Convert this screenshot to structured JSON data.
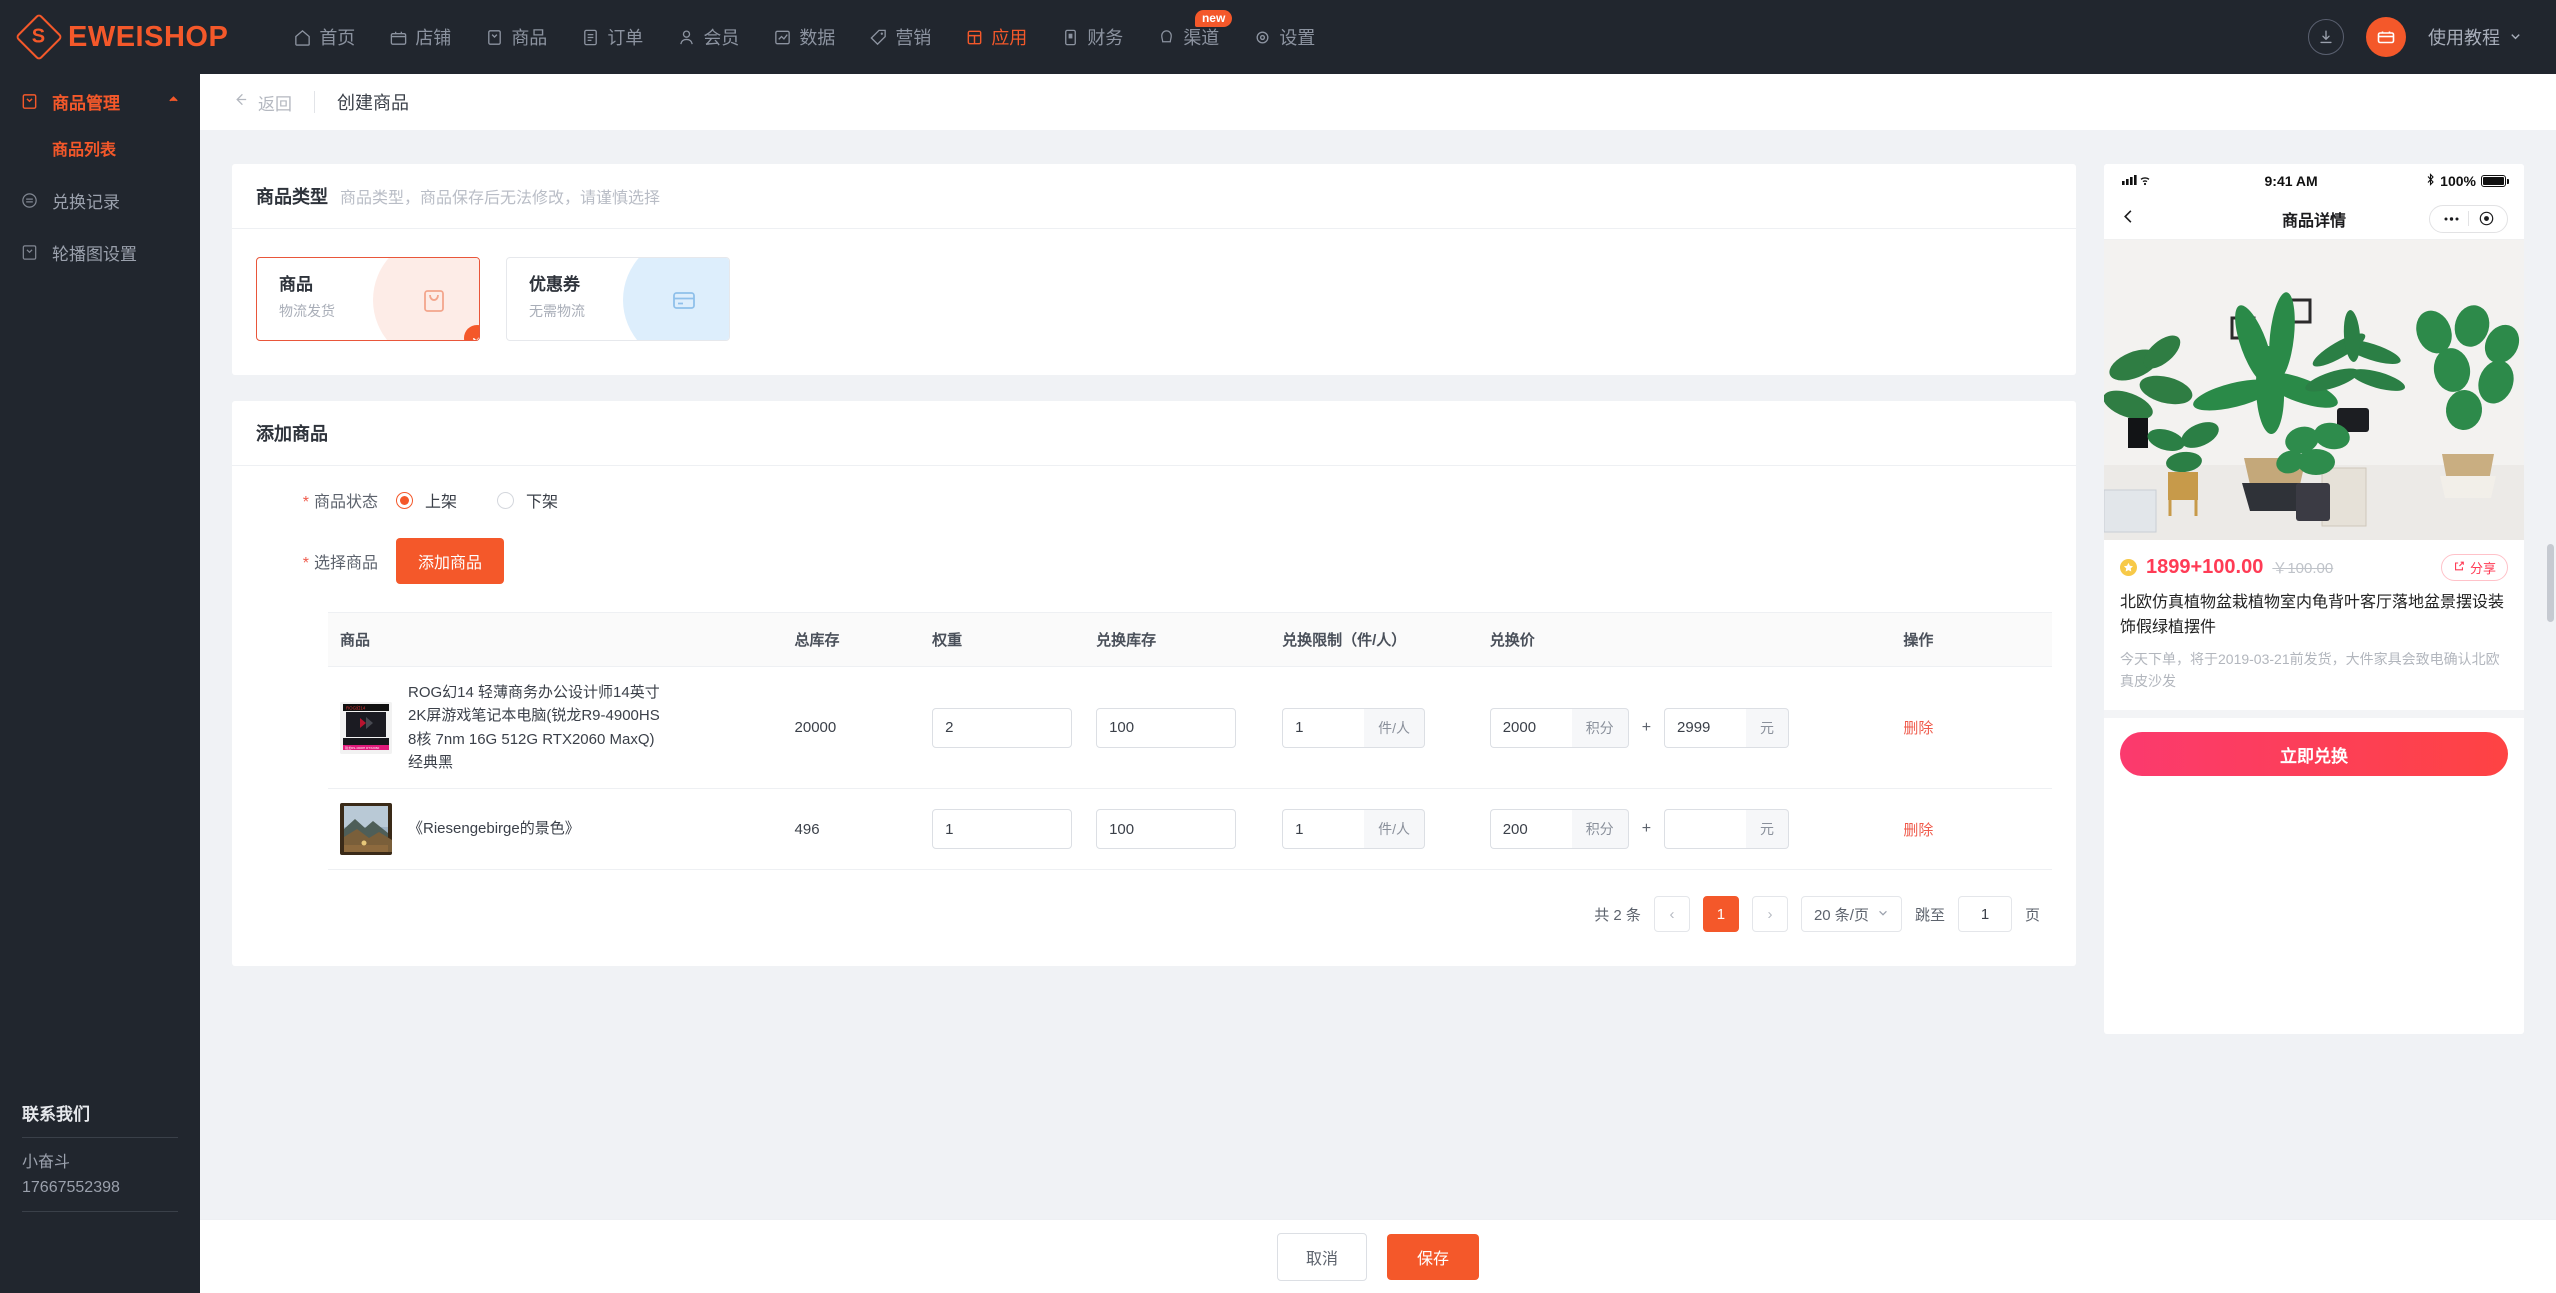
{
  "brand": {
    "name": "EWEISHOP",
    "color": "#f4582a"
  },
  "topnav": {
    "items": [
      {
        "label": "首页",
        "icon": "home-icon",
        "active": false
      },
      {
        "label": "店铺",
        "icon": "store-icon",
        "active": false
      },
      {
        "label": "商品",
        "icon": "goods-icon",
        "active": false
      },
      {
        "label": "订单",
        "icon": "order-icon",
        "active": false
      },
      {
        "label": "会员",
        "icon": "member-icon",
        "active": false
      },
      {
        "label": "数据",
        "icon": "chart-icon",
        "active": false
      },
      {
        "label": "营销",
        "icon": "tag-icon",
        "active": false
      },
      {
        "label": "应用",
        "icon": "app-icon",
        "active": true
      },
      {
        "label": "财务",
        "icon": "finance-icon",
        "active": false
      },
      {
        "label": "渠道",
        "icon": "channel-icon",
        "active": false,
        "badge": "new"
      },
      {
        "label": "设置",
        "icon": "gear-icon",
        "active": false
      }
    ],
    "download_icon": "download-icon",
    "avatar_icon": "shop-avatar-icon",
    "tutorial_label": "使用教程"
  },
  "sidebar": {
    "group": {
      "label": "商品管理",
      "icon": "goods-manage-icon",
      "caret": "caret-up-icon"
    },
    "sub": {
      "label": "商品列表"
    },
    "items": [
      {
        "label": "兑换记录",
        "icon": "exchange-record-icon"
      },
      {
        "label": "轮播图设置",
        "icon": "banner-setting-icon"
      }
    ],
    "contact": {
      "title": "联系我们",
      "name": "小奋斗",
      "phone": "17667552398"
    }
  },
  "breadcrumb": {
    "back_label": "返回",
    "title": "创建商品"
  },
  "type_section": {
    "title": "商品类型",
    "subtitle": "商品类型，商品保存后无法修改，请谨慎选择",
    "cards": [
      {
        "title": "商品",
        "sub": "物流发货",
        "selected": true,
        "icon": "bag-icon"
      },
      {
        "title": "优惠券",
        "sub": "无需物流",
        "selected": false,
        "icon": "coupon-icon"
      }
    ]
  },
  "add_section": {
    "title": "添加商品",
    "status_label": "商品状态",
    "status_options": [
      {
        "label": "上架",
        "checked": true
      },
      {
        "label": "下架",
        "checked": false
      }
    ],
    "select_label": "选择商品",
    "add_button": "添加商品"
  },
  "table": {
    "headers": [
      "商品",
      "总库存",
      "权重",
      "兑换库存",
      "兑换限制（件/人）",
      "兑换价",
      "操作"
    ],
    "rows": [
      {
        "name": "ROG幻14 轻薄商务办公设计师14英寸2K屏游戏笔记本电脑(锐龙R9-4900HS 8核 7nm 16G 512G RTX2060 MaxQ)经典黑",
        "thumb": "laptop-thumb",
        "stock": "20000",
        "weight": "2",
        "ex_stock": "100",
        "limit": "1",
        "limit_unit": "件/人",
        "points": "2000",
        "points_unit": "积分",
        "plus": "+",
        "money": "2999",
        "money_unit": "元",
        "action": "删除"
      },
      {
        "name": "《Riesengebirge的景色》",
        "thumb": "painting-thumb",
        "stock": "496",
        "weight": "1",
        "ex_stock": "100",
        "limit": "1",
        "limit_unit": "件/人",
        "points": "200",
        "points_unit": "积分",
        "plus": "+",
        "money": "",
        "money_unit": "元",
        "action": "删除"
      }
    ],
    "pagination": {
      "total": "共 2 条",
      "prev": "‹",
      "page": "1",
      "next": "›",
      "page_size": "20 条/页",
      "jump_label": "跳至",
      "jump_value": "1",
      "jump_unit": "页"
    }
  },
  "phone": {
    "status": {
      "time": "9:41 AM",
      "battery": "100%"
    },
    "nav_title": "商品详情",
    "back_icon": "chevron-left-icon",
    "more_icon": "more-dots-icon",
    "target_icon": "target-icon",
    "price": "1899+100.00",
    "old_price": "￥100.00",
    "share_label": "分享",
    "product_name": "北欧仿真植物盆栽植物室内龟背叶客厅落地盆景摆设装饰假绿植摆件",
    "description": "今天下单，将于2019-03-21前发货，大件家具会致电确认北欧真皮沙发",
    "cta": "立即兑换"
  },
  "footer": {
    "cancel": "取消",
    "save": "保存"
  }
}
